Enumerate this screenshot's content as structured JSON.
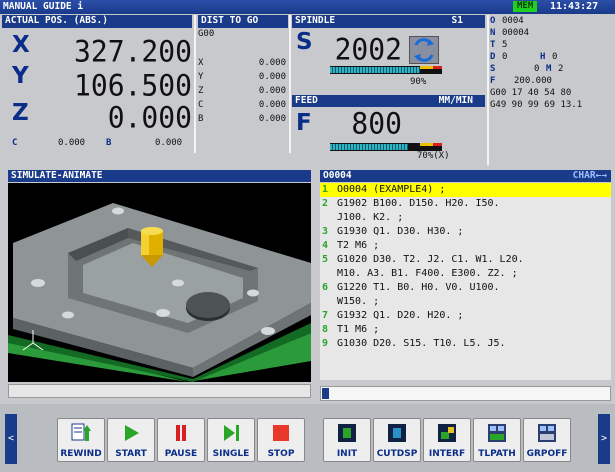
{
  "title_bar": {
    "title": "MANUAL GUIDE i",
    "mode": "MEM",
    "clock": "11:43:27"
  },
  "position": {
    "header": "ACTUAL POS. (ABS.)",
    "axes": [
      {
        "axis": "X",
        "value": "327.200"
      },
      {
        "axis": "Y",
        "value": "106.500"
      },
      {
        "axis": "Z",
        "value": "0.000"
      }
    ],
    "extra": {
      "c_label": "C",
      "c_value": "0.000",
      "b_label": "B",
      "b_value": "0.000"
    }
  },
  "dist_to_go": {
    "header": "DIST TO GO",
    "gcode": "G00",
    "rows": [
      {
        "axis": "X",
        "value": "0.000"
      },
      {
        "axis": "Y",
        "value": "0.000"
      },
      {
        "axis": "Z",
        "value": "0.000"
      },
      {
        "axis": "C",
        "value": "0.000"
      },
      {
        "axis": "B",
        "value": "0.000"
      }
    ]
  },
  "spindle": {
    "header": "SPINDLE",
    "id": "S1",
    "letter": "S",
    "value": "2002",
    "load": "90%"
  },
  "feed": {
    "header": "FEED",
    "unit": "MM/MIN",
    "letter": "F",
    "value": "800",
    "override": "70%(X)"
  },
  "modal": {
    "o": {
      "label": "O",
      "value": "0004"
    },
    "n": {
      "label": "N",
      "value": "00004"
    },
    "t": {
      "label": "T",
      "value": "5"
    },
    "d": {
      "label": "D",
      "value": "0"
    },
    "h": {
      "label": "H",
      "value": "0"
    },
    "s": {
      "label": "S",
      "value": "0"
    },
    "m": {
      "label": "M",
      "value": "2"
    },
    "f": {
      "label": "F",
      "value": "200.000"
    },
    "g1": "G00 17 40 54 80",
    "g2": "G49 90 99 69 13.1"
  },
  "simulate": {
    "header": "SIMULATE-ANIMATE"
  },
  "program": {
    "header": "O0004",
    "mode": "CHAR←→",
    "lines": [
      {
        "n": "1",
        "text": "O0004 (EXAMPLE4) ;",
        "cont": ""
      },
      {
        "n": "2",
        "text": "G1902 B100. D150. H20. I50.",
        "cont": "J100. K2. ;"
      },
      {
        "n": "3",
        "text": "G1930 Q1. D30. H30. ;",
        "cont": ""
      },
      {
        "n": "4",
        "text": "T2 M6 ;",
        "cont": ""
      },
      {
        "n": "5",
        "text": "G1020 D30. T2. J2. C1. W1. L20.",
        "cont": "M10. A3. B1. F400. E300. Z2. ;"
      },
      {
        "n": "6",
        "text": "G1220 T1. B0. H0. V0. U100.",
        "cont": "W150. ;"
      },
      {
        "n": "7",
        "text": "G1932 Q1. D20. H20. ;",
        "cont": ""
      },
      {
        "n": "8",
        "text": "T1 M6 ;",
        "cont": ""
      },
      {
        "n": "9",
        "text": "G1030 D20. S15. T10. L5. J5.",
        "cont": ""
      }
    ]
  },
  "softkeys": {
    "left": [
      {
        "label": "REWIND",
        "icon": "rewind-icon"
      },
      {
        "label": "START",
        "icon": "play-icon"
      },
      {
        "label": "PAUSE",
        "icon": "pause-icon"
      },
      {
        "label": "SINGLE",
        "icon": "single-step-icon"
      },
      {
        "label": "STOP",
        "icon": "stop-icon"
      }
    ],
    "right": [
      {
        "label": "INIT",
        "icon": "init-icon"
      },
      {
        "label": "CUTDSP",
        "icon": "cut-display-icon"
      },
      {
        "label": "INTERF",
        "icon": "interference-icon"
      },
      {
        "label": "TLPATH",
        "icon": "tool-path-icon"
      },
      {
        "label": "GRPOFF",
        "icon": "graphic-off-icon"
      }
    ]
  },
  "colors": {
    "header": "#1a3a8a",
    "axis": "#0a2d8a",
    "highlight": "#ffff00",
    "line_number": "#2aa52a",
    "mem": "#1fd11f"
  }
}
